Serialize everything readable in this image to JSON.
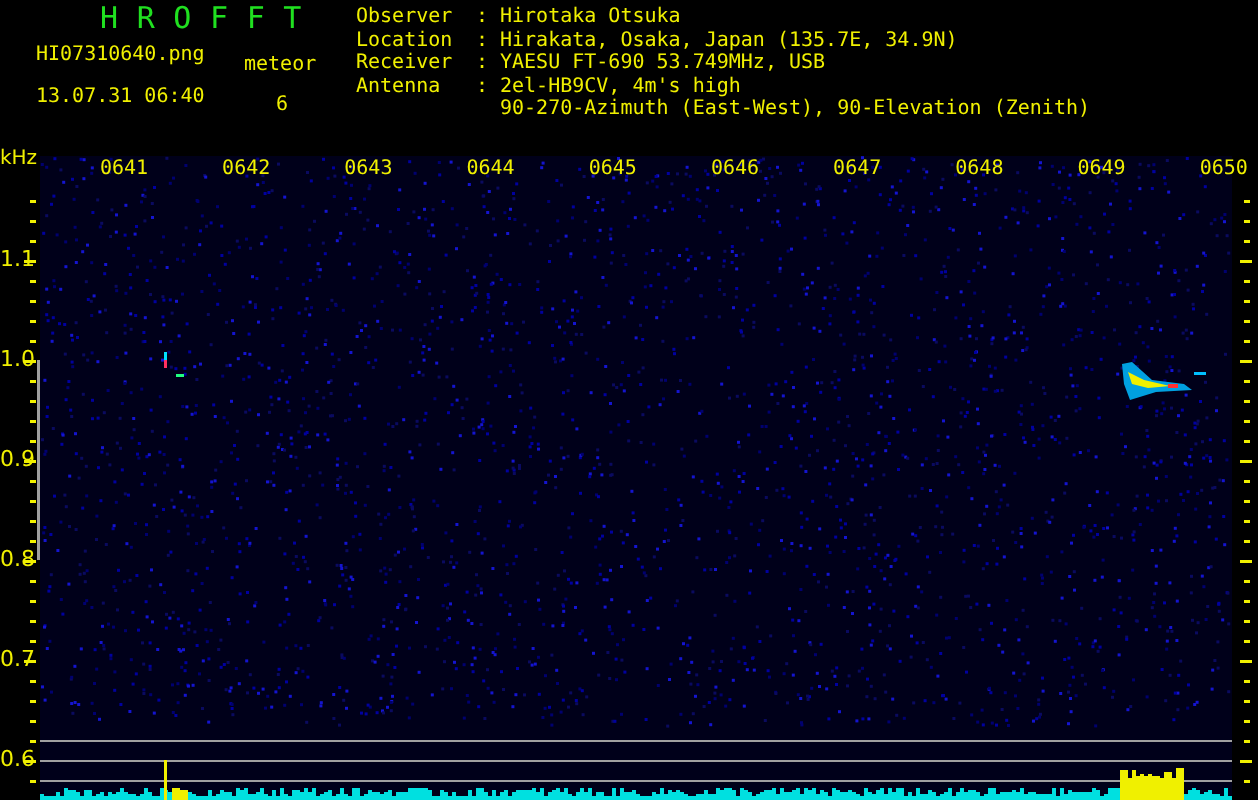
{
  "app": {
    "title": "HROFFT"
  },
  "file": {
    "name": "HI07310640.png",
    "timestamp": "13.07.31 06:40"
  },
  "meteor": {
    "label": "meteor",
    "count": "6"
  },
  "station": [
    {
      "label": "Observer",
      "separator": ":",
      "lines": [
        "Hirotaka Otsuka"
      ]
    },
    {
      "label": "Location",
      "separator": ":",
      "lines": [
        "Hirakata, Osaka, Japan (135.7E, 34.9N)"
      ]
    },
    {
      "label": "Receiver",
      "separator": ":",
      "lines": [
        "YAESU FT-690 53.749MHz, USB"
      ]
    },
    {
      "label": "Antenna",
      "separator": ":",
      "lines": [
        "2el-HB9CV, 4m's high",
        "90-270-Azimuth (East-West), 90-Elevation (Zenith)"
      ]
    }
  ],
  "chart": {
    "unit": "kHz",
    "x_labels": [
      "0641",
      "0642",
      "0643",
      "0644",
      "0645",
      "0646",
      "0647",
      "0648",
      "0649",
      "0650"
    ],
    "y_labels": [
      "1.1",
      "1.0",
      "0.9",
      "0.8",
      "0.7",
      "0.6"
    ]
  }
}
